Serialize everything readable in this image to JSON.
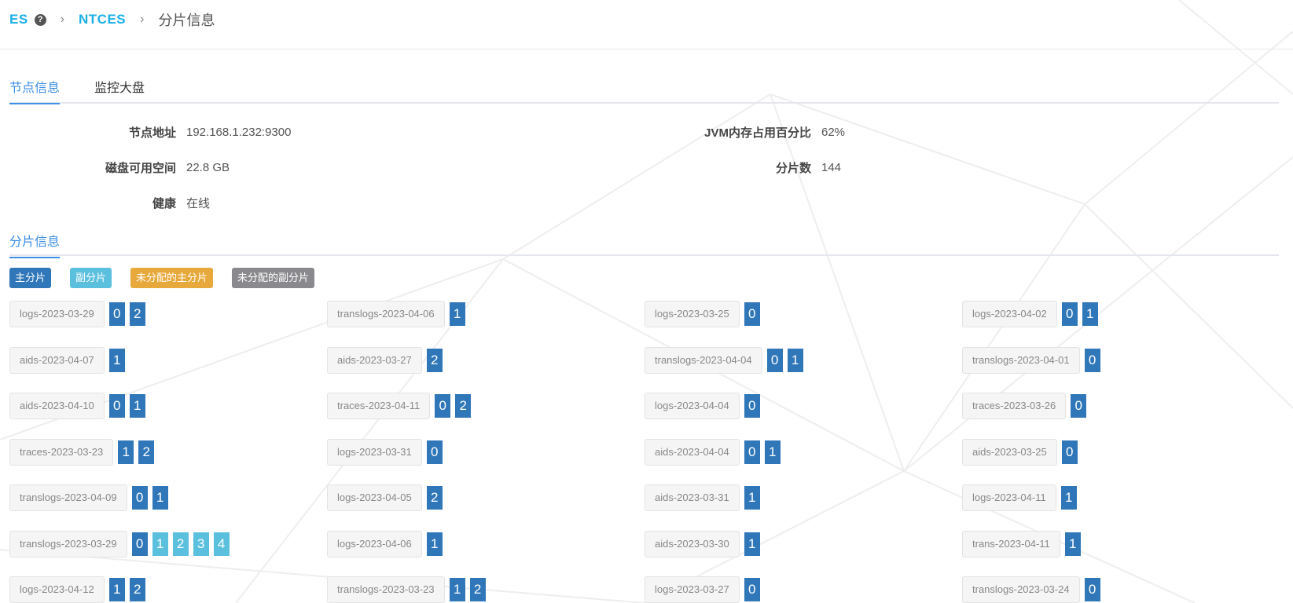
{
  "breadcrumb": {
    "root": "ES",
    "cluster": "NTCES",
    "current": "分片信息"
  },
  "tabs": [
    {
      "label": "节点信息",
      "active": true
    },
    {
      "label": "监控大盘",
      "active": false
    }
  ],
  "node_info": {
    "address_label": "节点地址",
    "address": "192.168.1.232:9300",
    "jvm_label": "JVM内存占用百分比",
    "jvm": "62%",
    "disk_label": "磁盘可用空间",
    "disk": "22.8 GB",
    "shards_label": "分片数",
    "shards": "144",
    "health_label": "健康",
    "health": "在线"
  },
  "shard_section": {
    "title": "分片信息"
  },
  "legend": [
    {
      "label": "主分片",
      "color": "#2f77b8"
    },
    {
      "label": "副分片",
      "color": "#5bc0de"
    },
    {
      "label": "未分配的主分片",
      "color": "#e8a93c"
    },
    {
      "label": "未分配的副分片",
      "color": "#8a8a8e"
    }
  ],
  "colors": {
    "accent": "#3a8ee6",
    "brand": "#1ab0e8",
    "primary_shard": "#2f77b8",
    "replica_shard": "#5bc0de"
  },
  "indices": [
    {
      "name": "logs-2023-03-29",
      "shards": [
        {
          "n": "0",
          "t": "p"
        },
        {
          "n": "2",
          "t": "p"
        }
      ]
    },
    {
      "name": "translogs-2023-04-06",
      "shards": [
        {
          "n": "1",
          "t": "p"
        }
      ]
    },
    {
      "name": "logs-2023-03-25",
      "shards": [
        {
          "n": "0",
          "t": "p"
        }
      ]
    },
    {
      "name": "logs-2023-04-02",
      "shards": [
        {
          "n": "0",
          "t": "p"
        },
        {
          "n": "1",
          "t": "p"
        }
      ]
    },
    {
      "name": "aids-2023-04-07",
      "shards": [
        {
          "n": "1",
          "t": "p"
        }
      ]
    },
    {
      "name": "aids-2023-03-27",
      "shards": [
        {
          "n": "2",
          "t": "p"
        }
      ]
    },
    {
      "name": "translogs-2023-04-04",
      "shards": [
        {
          "n": "0",
          "t": "p"
        },
        {
          "n": "1",
          "t": "p"
        }
      ]
    },
    {
      "name": "translogs-2023-04-01",
      "shards": [
        {
          "n": "0",
          "t": "p"
        }
      ]
    },
    {
      "name": "aids-2023-04-10",
      "shards": [
        {
          "n": "0",
          "t": "p"
        },
        {
          "n": "1",
          "t": "p"
        }
      ]
    },
    {
      "name": "traces-2023-04-11",
      "shards": [
        {
          "n": "0",
          "t": "p"
        },
        {
          "n": "2",
          "t": "p"
        }
      ]
    },
    {
      "name": "logs-2023-04-04",
      "shards": [
        {
          "n": "0",
          "t": "p"
        }
      ]
    },
    {
      "name": "traces-2023-03-26",
      "shards": [
        {
          "n": "0",
          "t": "p"
        }
      ]
    },
    {
      "name": "traces-2023-03-23",
      "shards": [
        {
          "n": "1",
          "t": "p"
        },
        {
          "n": "2",
          "t": "p"
        }
      ]
    },
    {
      "name": "logs-2023-03-31",
      "shards": [
        {
          "n": "0",
          "t": "p"
        }
      ]
    },
    {
      "name": "aids-2023-04-04",
      "shards": [
        {
          "n": "0",
          "t": "p"
        },
        {
          "n": "1",
          "t": "p"
        }
      ]
    },
    {
      "name": "aids-2023-03-25",
      "shards": [
        {
          "n": "0",
          "t": "p"
        }
      ]
    },
    {
      "name": "translogs-2023-04-09",
      "shards": [
        {
          "n": "0",
          "t": "p"
        },
        {
          "n": "1",
          "t": "p"
        }
      ]
    },
    {
      "name": "logs-2023-04-05",
      "shards": [
        {
          "n": "2",
          "t": "p"
        }
      ]
    },
    {
      "name": "aids-2023-03-31",
      "shards": [
        {
          "n": "1",
          "t": "p"
        }
      ]
    },
    {
      "name": "logs-2023-04-11",
      "shards": [
        {
          "n": "1",
          "t": "p"
        }
      ]
    },
    {
      "name": "translogs-2023-03-29",
      "shards": [
        {
          "n": "0",
          "t": "p"
        },
        {
          "n": "1",
          "t": "r"
        },
        {
          "n": "2",
          "t": "r"
        },
        {
          "n": "3",
          "t": "r"
        },
        {
          "n": "4",
          "t": "r"
        }
      ]
    },
    {
      "name": "logs-2023-04-06",
      "shards": [
        {
          "n": "1",
          "t": "p"
        }
      ]
    },
    {
      "name": "aids-2023-03-30",
      "shards": [
        {
          "n": "1",
          "t": "p"
        }
      ]
    },
    {
      "name": "trans-2023-04-11",
      "shards": [
        {
          "n": "1",
          "t": "p"
        }
      ]
    },
    {
      "name": "logs-2023-04-12",
      "shards": [
        {
          "n": "1",
          "t": "p"
        },
        {
          "n": "2",
          "t": "p"
        }
      ]
    },
    {
      "name": "translogs-2023-03-23",
      "shards": [
        {
          "n": "1",
          "t": "p"
        },
        {
          "n": "2",
          "t": "p"
        }
      ]
    },
    {
      "name": "logs-2023-03-27",
      "shards": [
        {
          "n": "0",
          "t": "p"
        }
      ]
    },
    {
      "name": "translogs-2023-03-24",
      "shards": [
        {
          "n": "0",
          "t": "p"
        }
      ]
    }
  ]
}
